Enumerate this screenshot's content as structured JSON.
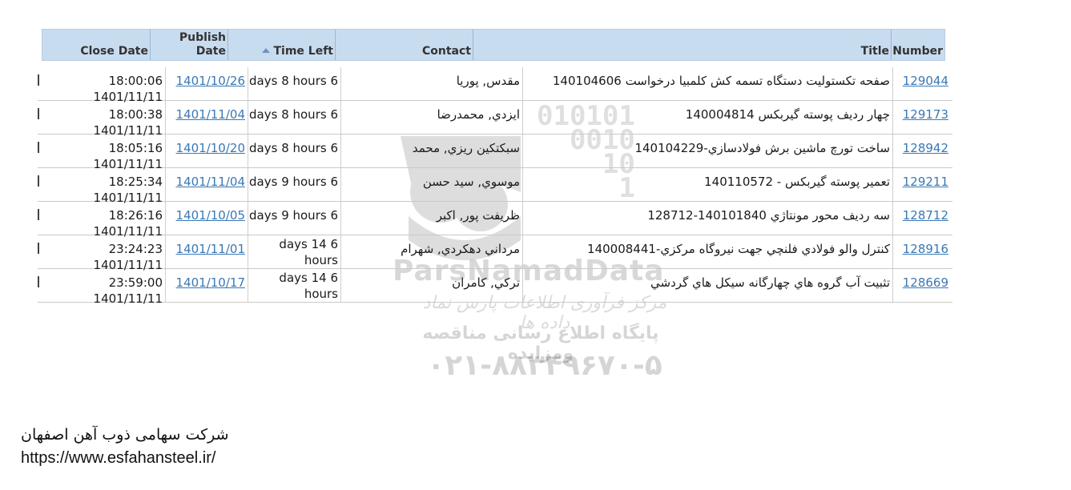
{
  "header": {
    "close_date": "Close Date",
    "publish_date_line1": "Publish",
    "publish_date_line2": "Date",
    "time_left": "Time Left",
    "contact": "Contact",
    "title": "Title",
    "number": "Number"
  },
  "rows": [
    {
      "close": "18:00:06 1401/11/11",
      "publish": "1401/10/26",
      "left1": "days 8 hours 6",
      "left2": "",
      "contact": "مقدس, پوريا",
      "title": "صفحه تکستوليت دستگاه تسمه کش کلمبيا درخواست 140104606",
      "number": "129044"
    },
    {
      "close": "18:00:38 1401/11/11",
      "publish": "1401/11/04",
      "left1": "days 8 hours 6",
      "left2": "",
      "contact": "ايزدي, محمدرضا",
      "title": "چهار رديف پوسته گيربکس 140004814",
      "number": "129173"
    },
    {
      "close": "18:05:16 1401/11/11",
      "publish": "1401/10/20",
      "left1": "days 8 hours 6",
      "left2": "",
      "contact": "سبکتکين ريزي, محمد",
      "title": "ساخت تورچ ماشين برش فولادسازي-140104229",
      "number": "128942"
    },
    {
      "close": "18:25:34 1401/11/11",
      "publish": "1401/11/04",
      "left1": "days 9 hours 6",
      "left2": "",
      "contact": "موسوي, سيد حسن",
      "title": "تعمير پوسته گيربکس - 140110572",
      "number": "129211"
    },
    {
      "close": "18:26:16 1401/11/11",
      "publish": "1401/10/05",
      "left1": "days 9 hours 6",
      "left2": "",
      "contact": "ظريفت پور, اکبر",
      "title": "سه رديف محور مونتاژي 140101840-128712",
      "number": "128712"
    },
    {
      "close": "23:24:23 1401/11/11",
      "publish": "1401/11/01",
      "left1": "days 14 6",
      "left2": "hours",
      "contact": "مرداني دهکردي, شهرام",
      "title": "کنترل والو فولادي فلنچي جهت نيروگاه مرکزي-140008441",
      "number": "128916"
    },
    {
      "close": "23:59:00 1401/11/11",
      "publish": "1401/10/17",
      "left1": "days 14 6",
      "left2": "hours",
      "contact": "ترکي, کامران",
      "title": "تثبيت آب گروه هاي چهارگانه سيکل هاي گردشي",
      "number": "128669"
    }
  ],
  "watermark": {
    "digits": "010101\n  0010\n    10\n     1",
    "brand": "ParsNamadData",
    "line1": "مرکز فرآوری اطلاعات پارس نماد داده ها",
    "line2": "پایگاه اطلاع رسانی مناقصه ومزایده",
    "phone": "۰۲۱-۸۸۳۴۹۶۷۰-۵"
  },
  "footer": {
    "company": "شرکت سهامی ذوب آهن اصفهان",
    "url": "https://www.esfahansteel.ir/"
  },
  "colors": {
    "header_bg": "#c8dcf0",
    "link": "#3a78b5"
  }
}
